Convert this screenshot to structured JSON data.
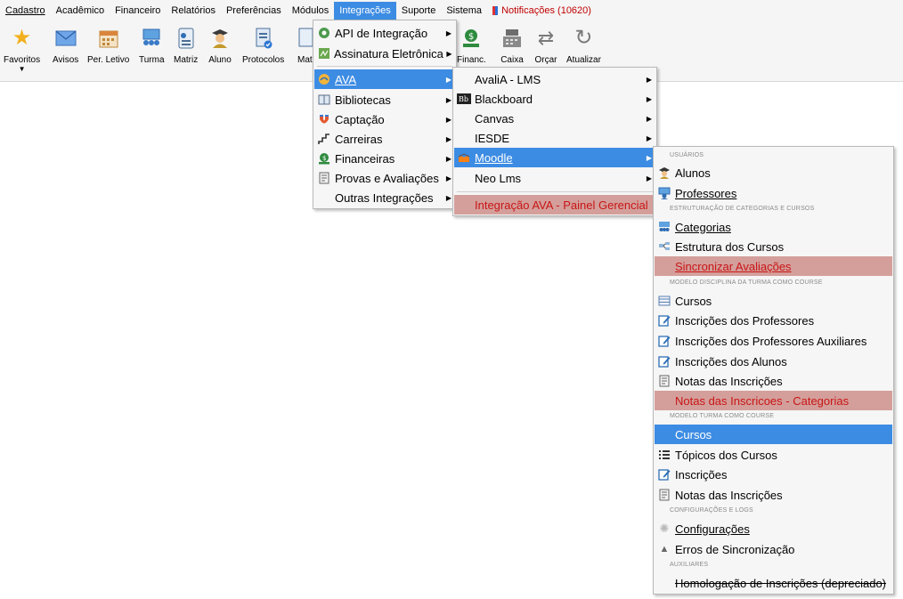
{
  "menubar": {
    "items": [
      "Cadastro",
      "Acadêmico",
      "Financeiro",
      "Relatórios",
      "Preferências",
      "Módulos",
      "Integrações",
      "Suporte",
      "Sistema"
    ],
    "notifications": "Notificações (10620)"
  },
  "toolbar": {
    "buttons": [
      "Favoritos",
      "Avisos",
      "Per. Letivo",
      "Turma",
      "Matriz",
      "Aluno",
      "Protocolos",
      "Matr",
      "Financ.",
      "Caixa",
      "Orçar",
      "Atualizar"
    ]
  },
  "menu_integracoes": {
    "items": [
      "API de Integração",
      "Assinatura Eletrônica",
      "AVA",
      "Bibliotecas",
      "Captação",
      "Carreiras",
      "Financeiras",
      "Provas e Avaliações",
      "Outras Integrações"
    ]
  },
  "menu_ava": {
    "items": [
      "AvaliA - LMS",
      "Blackboard",
      "Canvas",
      "IESDE",
      "Moodle",
      "Neo Lms"
    ],
    "painel": "Integração AVA - Painel Gerencial"
  },
  "menu_moodle": {
    "cat_usuarios": "USUÁRIOS",
    "alunos": "Alunos",
    "professores": "Professores",
    "cat_estruturacao": "ESTRUTURAÇÃO DE CATEGORIAS E CURSOS",
    "categorias": "Categorias",
    "estrutura": "Estrutura dos Cursos",
    "sincronizar": "Sincronizar Avaliações",
    "cat_modelo_disc": "MODELO DISCIPLINA DA TURMA COMO COURSE",
    "cursos1": "Cursos",
    "insc_prof": "Inscrições dos Professores",
    "insc_prof_aux": "Inscrições dos Professores Auxiliares",
    "insc_alunos": "Inscrições dos Alunos",
    "notas_insc1": "Notas das Inscrições",
    "notas_insc_cat": "Notas das Inscricoes - Categorias",
    "cat_modelo_turma": "MODELO TURMA COMO COURSE",
    "cursos2": "Cursos",
    "topicos": "Tópicos dos Cursos",
    "inscricoes": "Inscrições",
    "notas_insc2": "Notas das Inscrições",
    "cat_config": "CONFIGURAÇÕES E LOGS",
    "configuracoes": "Configurações",
    "erros": "Erros de Sincronização",
    "cat_aux": "AUXILIARES",
    "homologacao": "Homologação de Inscrições (depreciado)"
  }
}
